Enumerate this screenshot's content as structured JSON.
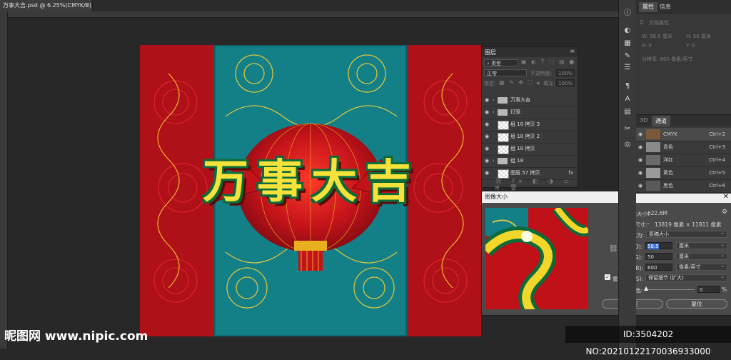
{
  "document": {
    "tab_title": "万事大吉.psd @ 6.25%(CMYK/8)",
    "close": "×"
  },
  "artwork": {
    "headline": "万事大吉"
  },
  "properties": {
    "tabs": [
      "属性",
      "信息"
    ],
    "doc_label": "文档属性",
    "w": "W: 58.5 厘米",
    "h": "H: 50 厘米",
    "x": "X: 0",
    "y": "Y: 0",
    "res": "分辨率: 600 像素/英寸"
  },
  "channels": {
    "tabs": [
      "3D",
      "通道"
    ],
    "rows": [
      {
        "name": "CMYK",
        "shortcut": "Ctrl+2"
      },
      {
        "name": "青色",
        "shortcut": "Ctrl+3"
      },
      {
        "name": "洋红",
        "shortcut": "Ctrl+4"
      },
      {
        "name": "黄色",
        "shortcut": "Ctrl+5"
      },
      {
        "name": "黑色",
        "shortcut": "Ctrl+6"
      }
    ]
  },
  "layers": {
    "title": "图层",
    "filter": "类型",
    "blend_mode": "正常",
    "opacity_label": "不透明度:",
    "opacity": "100%",
    "lock_label": "锁定:",
    "fill_label": "填充:",
    "fill": "100%",
    "rows": [
      {
        "name": "万事大吉",
        "kind": "folder"
      },
      {
        "name": "灯笼",
        "kind": "folder"
      },
      {
        "name": "组 18 拷贝 3",
        "kind": "layer"
      },
      {
        "name": "组 18 拷贝 2",
        "kind": "layer"
      },
      {
        "name": "组 18 拷贝",
        "kind": "layer"
      },
      {
        "name": "组 18",
        "kind": "folder"
      },
      {
        "name": "图层 57 拷贝",
        "kind": "layer",
        "badge": "fx"
      }
    ]
  },
  "dialog": {
    "title": "图像大小",
    "close": "✕",
    "image_size_label": "图像大小:",
    "image_size_value": "622.6M",
    "dimensions_label": "尺寸:",
    "dimensions_value": "13819 像素 × 11811 像素",
    "fit_label": "调整为:",
    "fit_value": "原稿大小",
    "width_label": "宽度(D):",
    "width_value": "58.5",
    "width_unit": "厘米",
    "height_label": "高度(G):",
    "height_value": "50",
    "height_unit": "厘米",
    "resolution_label": "分辨率(R):",
    "resolution_value": "600",
    "resolution_unit": "像素/英寸",
    "resample_label": "重新采样(S):",
    "resample_value": "保留细节 (扩大)",
    "noise_label": "减少杂色:",
    "noise_value": "0",
    "noise_unit": "%",
    "ok": "确定",
    "cancel": "复位"
  },
  "watermark": {
    "left": "昵图网 www.nipic.com",
    "right": "ID:3504202 NO:20210122170036933000"
  }
}
